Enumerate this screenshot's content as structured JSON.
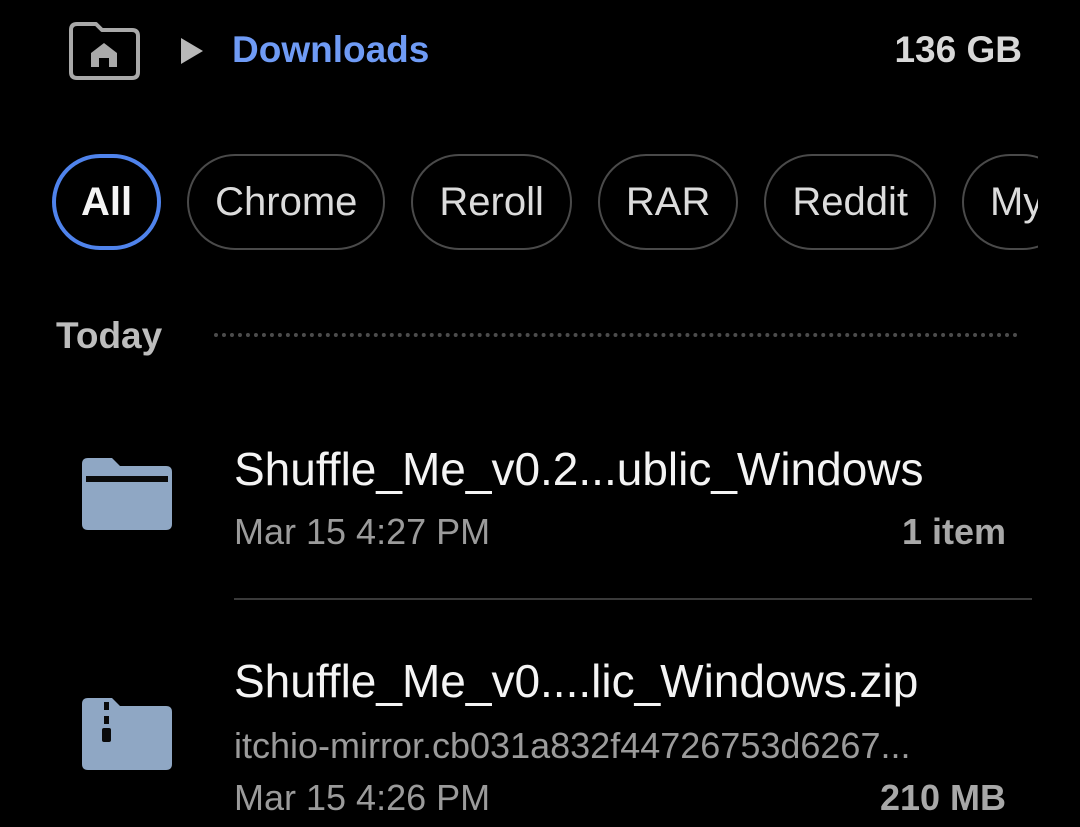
{
  "header": {
    "home_icon": "home-folder-icon",
    "arrow_icon": "breadcrumb-arrow-icon",
    "current_folder": "Downloads",
    "storage": "136 GB"
  },
  "filters": {
    "chips": [
      "All",
      "Chrome",
      "Reroll",
      "RAR",
      "Reddit",
      "My"
    ],
    "selected": "All"
  },
  "section": {
    "label": "Today"
  },
  "files": [
    {
      "icon": "folder-icon",
      "name": "Shuffle_Me_v0.2...ublic_Windows",
      "date": "Mar 15 4:27 PM",
      "detail": "1 item"
    },
    {
      "icon": "zip-archive-icon",
      "name": "Shuffle_Me_v0....lic_Windows.zip",
      "source": "itchio-mirror.cb031a832f44726753d6267...",
      "date": "Mar 15 4:26 PM",
      "detail": "210 MB"
    }
  ],
  "colors": {
    "background": "#000000",
    "accent": "#4f83ec",
    "breadcrumb_text": "#6f9bf5",
    "icon_fill": "#8fa7c4"
  }
}
